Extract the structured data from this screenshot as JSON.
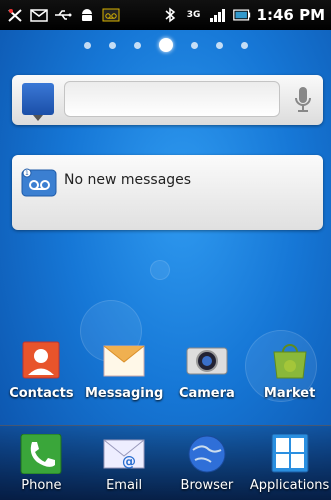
{
  "status_bar": {
    "time": "1:46 PM",
    "network_label": "3G",
    "left_icons": [
      "missed-call-icon",
      "email-notification-icon",
      "usb-icon",
      "android-debug-icon",
      "voicemail-icon"
    ],
    "right_icons": [
      "bluetooth-icon",
      "network-3g-icon",
      "signal-icon",
      "battery-icon"
    ]
  },
  "home": {
    "page_count": 7,
    "active_page": 3
  },
  "search_widget": {
    "icon": "google-search-icon",
    "placeholder": "",
    "mic_icon": "microphone-icon"
  },
  "message_widget": {
    "text": "No new messages",
    "icon": "voicemail-icon"
  },
  "apps": [
    {
      "label": "Contacts",
      "icon": "contacts-icon"
    },
    {
      "label": "Messaging",
      "icon": "messaging-icon"
    },
    {
      "label": "Camera",
      "icon": "camera-icon"
    },
    {
      "label": "Market",
      "icon": "market-icon"
    }
  ],
  "dock": [
    {
      "label": "Phone",
      "icon": "phone-icon"
    },
    {
      "label": "Email",
      "icon": "email-icon"
    },
    {
      "label": "Browser",
      "icon": "browser-icon"
    },
    {
      "label": "Applications",
      "icon": "applications-icon"
    }
  ]
}
